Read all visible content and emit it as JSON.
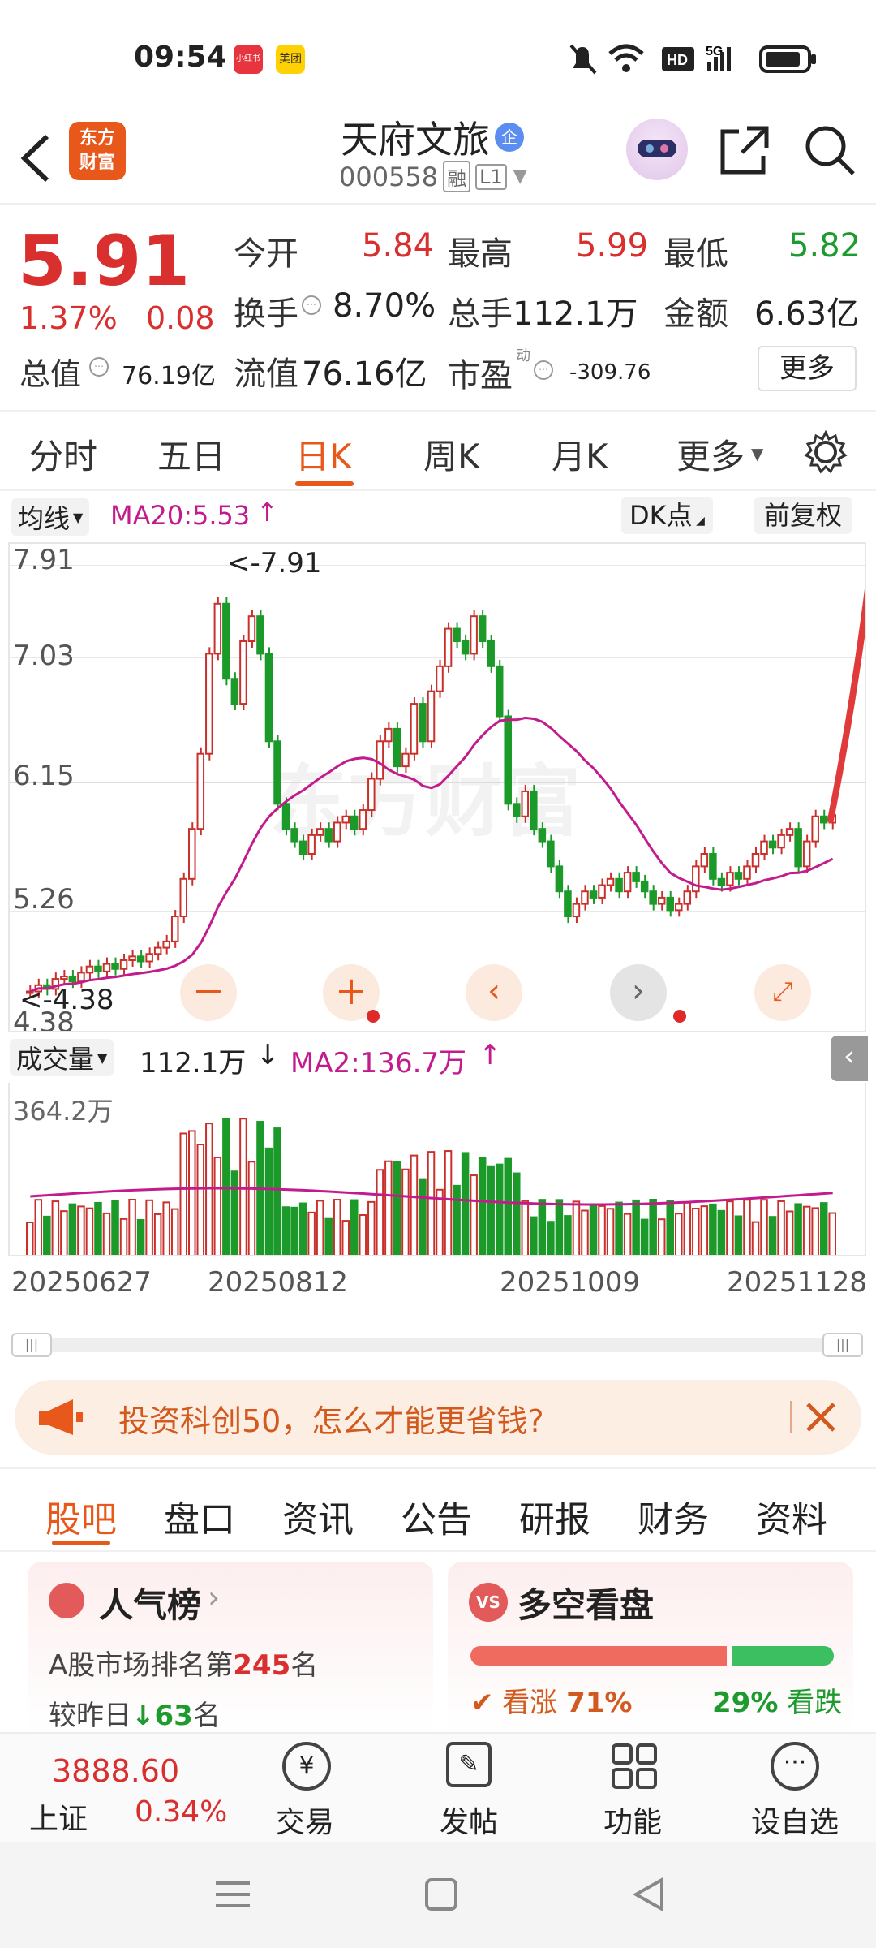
{
  "status": {
    "time": "09:54",
    "app1": "小红书",
    "app2": "美团",
    "net": "5G",
    "hd": "HD1"
  },
  "header": {
    "name": "天府文旅",
    "code": "000558",
    "rz": "融",
    "level": "L1",
    "logo": "东方\n财富",
    "badge": "企"
  },
  "quote": {
    "price": "5.91",
    "pct": "1.37%",
    "chg": "0.08",
    "fields": [
      {
        "l": "今开",
        "v": "5.84"
      },
      {
        "l": "最高",
        "v": "5.99"
      },
      {
        "l": "最低",
        "v": "5.82"
      },
      {
        "l": "换手",
        "v": "8.70%"
      },
      {
        "l": "总手",
        "v": "112.1万"
      },
      {
        "l": "金额",
        "v": "6.63亿"
      },
      {
        "l": "总值",
        "v": "76.19亿"
      },
      {
        "l": "流值",
        "v": "76.16亿"
      },
      {
        "l": "市盈",
        "v": "-309.76"
      }
    ],
    "pe_sup": "动",
    "more": "更多"
  },
  "tabs": [
    "分时",
    "五日",
    "日K",
    "周K",
    "月K",
    "更多"
  ],
  "chart": {
    "ma_selector": "均线",
    "ma20": "MA20:5.53",
    "dk": "DK点",
    "fq": "前复权",
    "yticks": [
      "7.91",
      "7.03",
      "6.15",
      "5.26",
      "4.38"
    ],
    "high_label": "<-7.91",
    "low_label": "<-4.38",
    "vol_selector": "成交量",
    "vol": "112.1万",
    "ma2": "MA2:136.7万",
    "vol_tick": "364.2万",
    "dates": [
      "20250627",
      "20250812",
      "20251009",
      "20251128"
    ],
    "watermark": "东方财富"
  },
  "chart_data": {
    "type": "candlestick",
    "ylim": [
      4.38,
      7.91
    ],
    "last_close": 5.91,
    "ma20_last": 5.53,
    "high": 7.91,
    "low": 4.38,
    "volume_max": "364.2万"
  },
  "notice": {
    "text": "投资科创50，怎么才能更省钱?"
  },
  "subtabs": [
    "股吧",
    "盘口",
    "资讯",
    "公告",
    "研报",
    "财务",
    "资料"
  ],
  "cards": {
    "pop_title": "人气榜",
    "pop_line1": "A股市场排名第",
    "pop_rank": "245",
    "pop_unit": "名",
    "pop_line2": "较昨日",
    "pop_chg": "63",
    "pop_unit2": "名",
    "vs_title": "多空看盘",
    "bull": "看涨",
    "bull_pct": "71%",
    "bear": "看跌",
    "bear_pct": "29%"
  },
  "bottom": {
    "index": "3888.60",
    "index_name": "上证",
    "index_pct": "0.34%",
    "items": [
      "交易",
      "发帖",
      "功能",
      "设自选"
    ]
  }
}
